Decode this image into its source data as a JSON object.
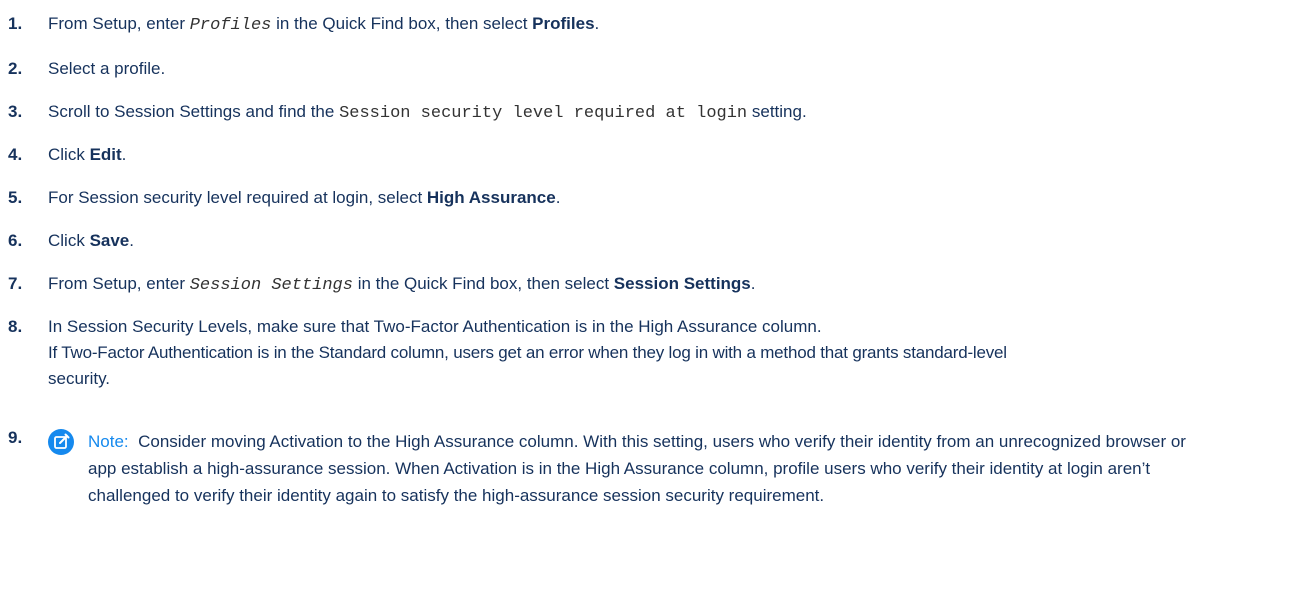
{
  "steps": [
    {
      "number": "1.",
      "pre": "From Setup, enter ",
      "code": "Profiles",
      "mid": " in the Quick Find box, then select ",
      "bold": "Profiles",
      "post": "."
    },
    {
      "number": "2.",
      "text": "Select a profile."
    },
    {
      "number": "3.",
      "pre": "Scroll to Session Settings and find the ",
      "code": "Session security level required at login",
      "post": " setting."
    },
    {
      "number": "4.",
      "pre": "Click ",
      "bold": "Edit",
      "post": "."
    },
    {
      "number": "5.",
      "pre": "For Session security level required at login, select ",
      "bold": "High Assurance",
      "post": "."
    },
    {
      "number": "6.",
      "pre": "Click ",
      "bold": "Save",
      "post": "."
    },
    {
      "number": "7.",
      "pre": "From Setup, enter ",
      "code": "Session Settings",
      "mid": " in the Quick Find box, then select ",
      "bold": "Session Settings",
      "post": "."
    },
    {
      "number": "8.",
      "line1": "In Session Security Levels, make sure that Two-Factor Authentication is in the High Assurance column.",
      "line2": "If Two-Factor Authentication is in the Standard column, users get an error when they log in with a method that grants standard-level",
      "line3": "security."
    },
    {
      "number": "9.",
      "note_label": "Note:",
      "note_text": "Consider moving Activation to the High Assurance column. With this setting, users who verify their identity from an unrecognized browser or app establish a high-assurance session. When Activation is in the High Assurance column, profile users who verify their identity at login aren’t challenged to verify their identity again to satisfy the high-assurance session security requirement.",
      "note_icon": "edit-note-icon"
    }
  ],
  "colors": {
    "text": "#16325c",
    "accent": "#1589ee"
  }
}
